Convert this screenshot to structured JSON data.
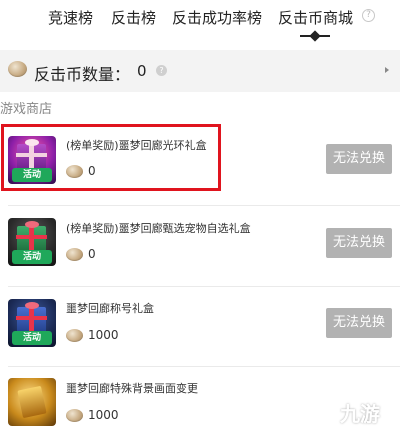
{
  "tabs": [
    {
      "label": "竞速榜"
    },
    {
      "label": "反击榜"
    },
    {
      "label": "反击成功率榜"
    },
    {
      "label": "反击币商城",
      "active": true
    }
  ],
  "coin_bar": {
    "label": "反击币数量：",
    "count": "0"
  },
  "section_title": "游戏商店",
  "items": [
    {
      "name": "(榜单奖励)噩梦回廊光环礼盒",
      "price": "0",
      "button": "无法兑换",
      "tag": "活动",
      "icon": "purple-gift-box-icon",
      "highlighted": true
    },
    {
      "name": "(榜单奖励)噩梦回廊甄选宠物自选礼盒",
      "price": "0",
      "button": "无法兑换",
      "tag": "活动",
      "icon": "green-gift-box-icon"
    },
    {
      "name": "噩梦回廊称号礼盒",
      "price": "1000",
      "button": "无法兑换",
      "tag": "活动",
      "icon": "blue-gift-box-icon"
    },
    {
      "name": "噩梦回廊特殊背景画面变更",
      "price": "1000",
      "button": "",
      "tag": "",
      "icon": "gold-item-icon"
    }
  ],
  "colors": {
    "highlight": "#e0141e",
    "button_disabled": "#b2b2b2",
    "coin_bar_bg": "#f3f3f3"
  },
  "watermark": {
    "text": "九游",
    "icon": "9game-logo-icon"
  }
}
